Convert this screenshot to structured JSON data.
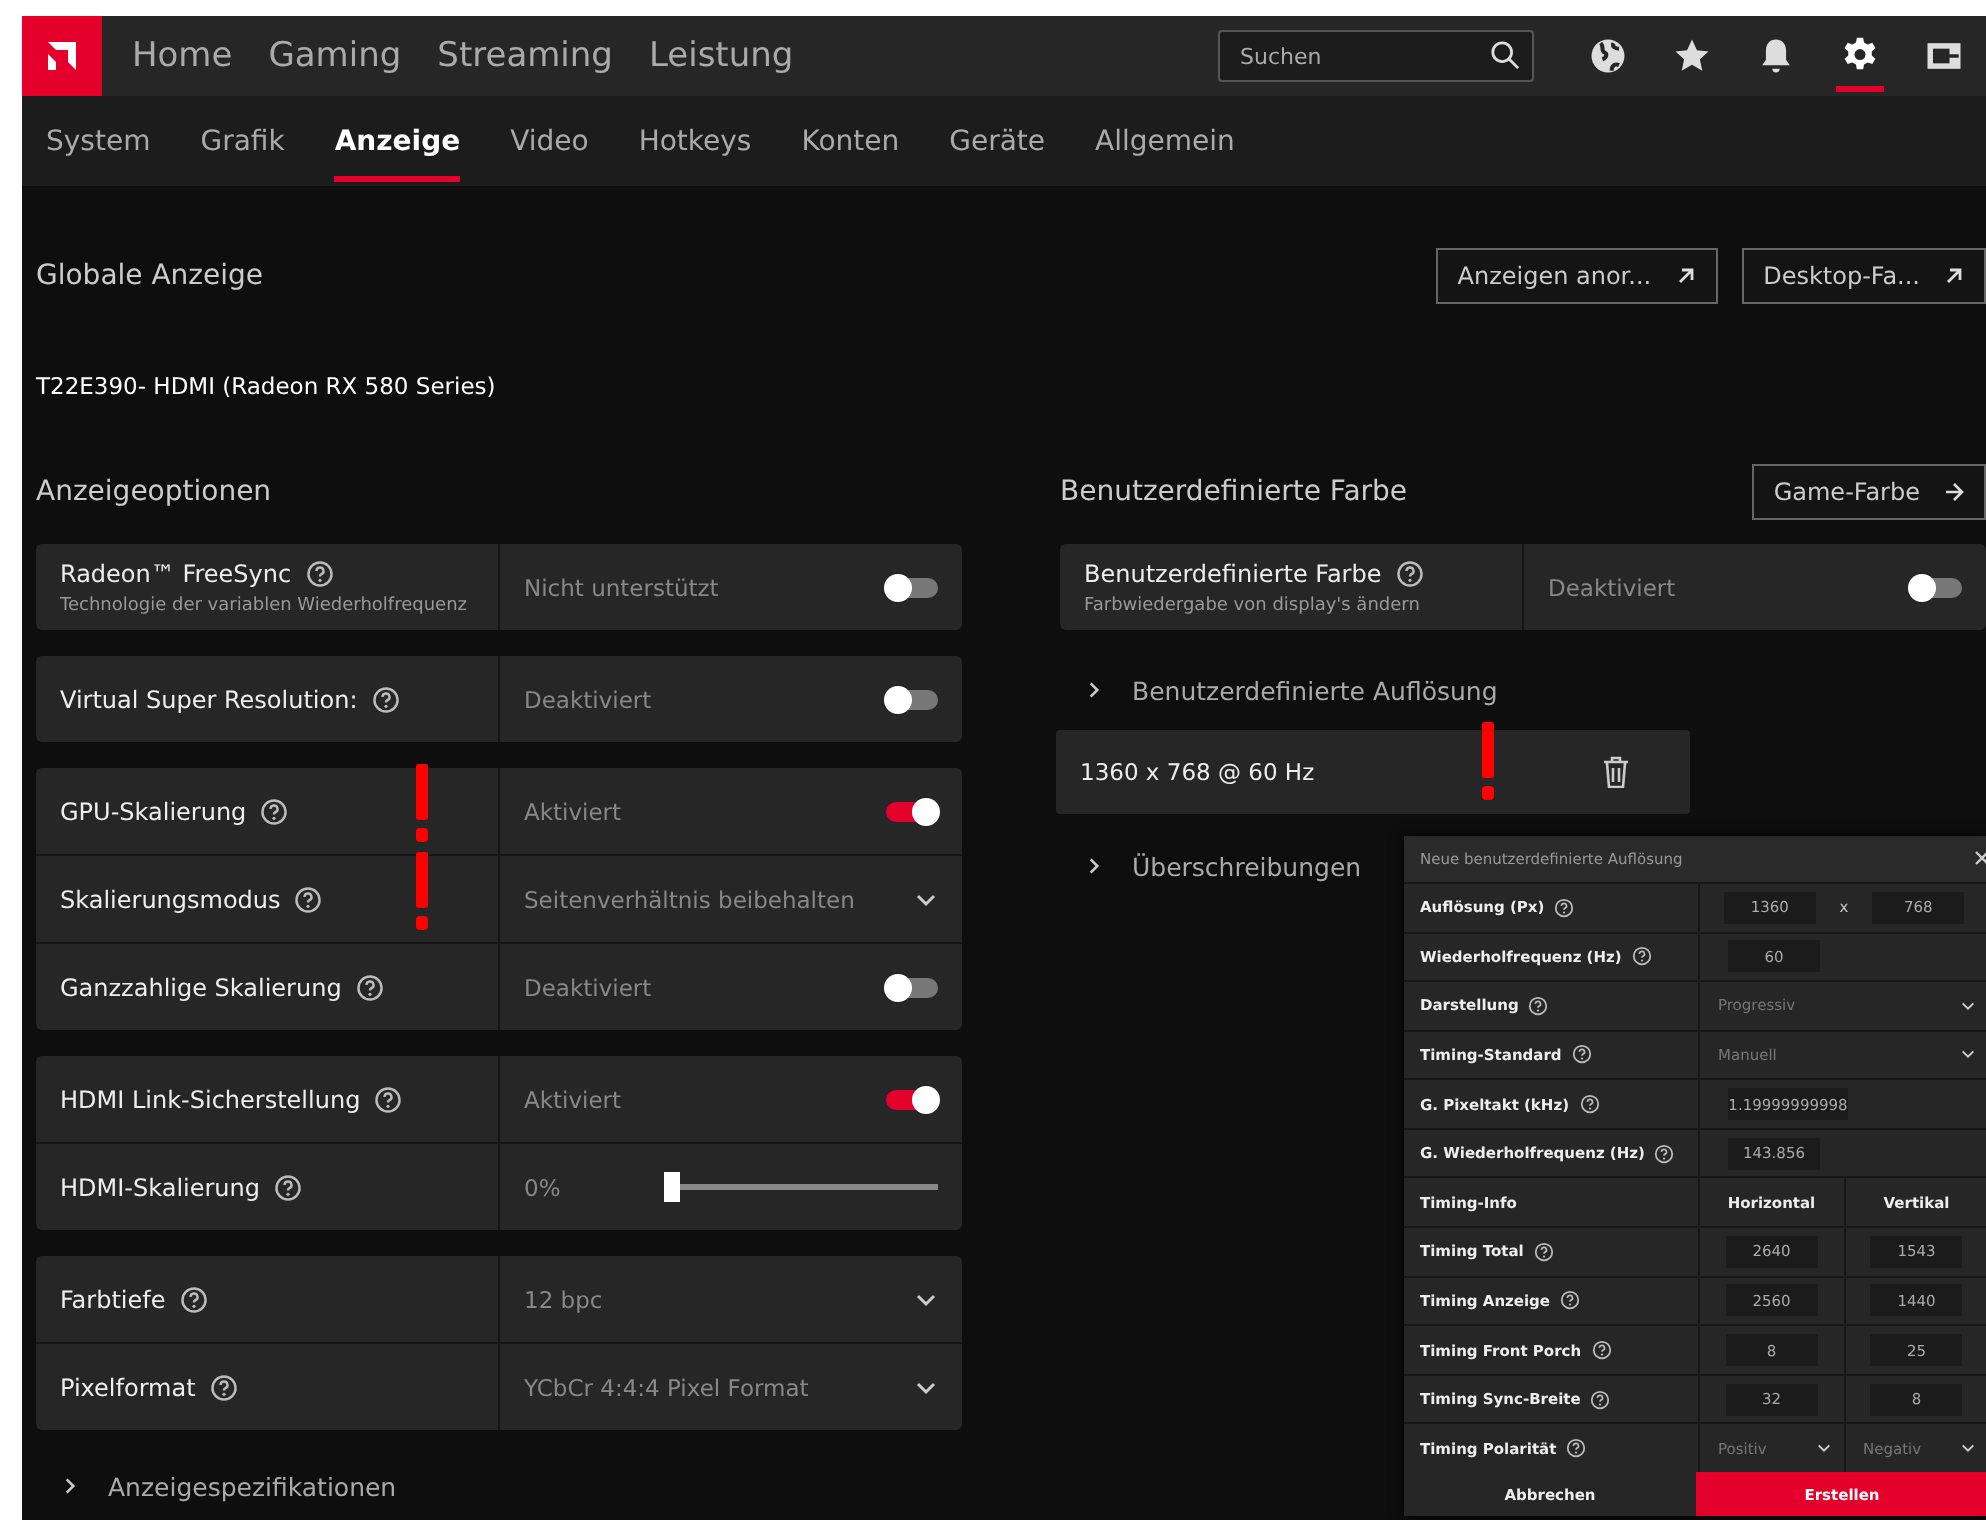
{
  "top_nav": {
    "items": [
      {
        "label": "Home",
        "selected": false
      },
      {
        "label": "Gaming",
        "selected": false
      },
      {
        "label": "Streaming",
        "selected": false
      },
      {
        "label": "Leistung",
        "selected": false
      }
    ],
    "search": {
      "placeholder": "Suchen"
    },
    "icons": [
      {
        "kind": "globe",
        "selected": false
      },
      {
        "kind": "star",
        "selected": false
      },
      {
        "kind": "bell",
        "selected": false
      },
      {
        "kind": "gear",
        "selected": true
      },
      {
        "kind": "exit",
        "selected": false
      }
    ]
  },
  "tabs": [
    {
      "label": "System",
      "selected": false
    },
    {
      "label": "Grafik",
      "selected": false
    },
    {
      "label": "Anzeige",
      "selected": true
    },
    {
      "label": "Video",
      "selected": false
    },
    {
      "label": "Hotkeys",
      "selected": false
    },
    {
      "label": "Konten",
      "selected": false
    },
    {
      "label": "Geräte",
      "selected": false
    },
    {
      "label": "Allgemein",
      "selected": false
    }
  ],
  "header": {
    "title": "Globale Anzeige",
    "buttons": [
      "Anzeigen anor...",
      "Desktop-Fa..."
    ],
    "display_name": "T22E390- HDMI (Radeon RX 580 Series)"
  },
  "display_options": {
    "title": "Anzeigeoptionen",
    "groups": [
      [
        {
          "label": "Radeon™ FreeSync",
          "subtitle": "Technologie der variablen Wiederholfrequenz",
          "kind": "toggle",
          "value": "Nicht unterstützt",
          "on": false,
          "flagged": false
        }
      ],
      [
        {
          "label": "Virtual Super Resolution:",
          "kind": "toggle",
          "value": "Deaktiviert",
          "on": false,
          "flagged": false
        }
      ],
      [
        {
          "label": "GPU-Skalierung",
          "kind": "toggle",
          "value": "Aktiviert",
          "on": true,
          "flagged": true
        },
        {
          "label": "Skalierungsmodus",
          "kind": "dropdown",
          "value": "Seitenverhältnis beibehalten",
          "flagged": true
        },
        {
          "label": "Ganzzahlige Skalierung",
          "kind": "toggle",
          "value": "Deaktiviert",
          "on": false,
          "flagged": false
        }
      ],
      [
        {
          "label": "HDMI Link-Sicherstellung",
          "kind": "toggle",
          "value": "Aktiviert",
          "on": true,
          "flagged": false
        },
        {
          "label": "HDMI-Skalierung",
          "kind": "slider",
          "value": "0%",
          "level": 0,
          "flagged": false
        }
      ],
      [
        {
          "label": "Farbtiefe",
          "kind": "dropdown",
          "value": "12 bpc",
          "flagged": false
        },
        {
          "label": "Pixelformat",
          "kind": "dropdown",
          "value": "YCbCr 4:4:4 Pixel Format",
          "flagged": false
        }
      ]
    ],
    "footer": "Anzeigespezifikationen"
  },
  "custom_color": {
    "title": "Benutzerdefinierte Farbe",
    "button": "Game-Farbe",
    "setting": {
      "label": "Benutzerdefinierte Farbe",
      "subtitle": "Farbwiedergabe von display's ändern",
      "kind": "toggle",
      "value": "Deaktiviert",
      "on": false
    },
    "custom_resolution": {
      "label": "Benutzerdefinierte Auflösung",
      "expanded": false,
      "items": [
        {
          "label": "1360 x 768 @ 60 Hz",
          "flagged": true
        }
      ]
    },
    "overrides": {
      "label": "Überschreibungen",
      "expanded": false
    }
  },
  "dialog": {
    "title": "Neue benutzerdefinierte Auflösung",
    "rows": [
      {
        "label": "Auflösung (Px)",
        "kind": "pair",
        "values": [
          "1360",
          "768"
        ],
        "separator": "x"
      },
      {
        "label": "Wiederholfrequenz (Hz)",
        "kind": "input",
        "values": [
          "60"
        ]
      },
      {
        "label": "Darstellung",
        "kind": "dropdown",
        "values": [
          "Progressiv"
        ]
      },
      {
        "label": "Timing-Standard",
        "kind": "dropdown",
        "values": [
          "Manuell"
        ]
      },
      {
        "label": "G. Pixeltakt (kHz)",
        "kind": "input",
        "values": [
          "1.19999999998"
        ]
      },
      {
        "label": "G. Wiederholfrequenz (Hz)",
        "kind": "input",
        "values": [
          "143.856"
        ]
      },
      {
        "label": "Timing-Info",
        "kind": "header",
        "values": [
          "Horizontal",
          "Vertikal"
        ]
      },
      {
        "label": "Timing Total",
        "kind": "pair",
        "values": [
          "2640",
          "1543"
        ]
      },
      {
        "label": "Timing Anzeige",
        "kind": "pair",
        "values": [
          "2560",
          "1440"
        ]
      },
      {
        "label": "Timing Front Porch",
        "kind": "pair",
        "values": [
          "8",
          "25"
        ]
      },
      {
        "label": "Timing Sync-Breite",
        "kind": "pair",
        "values": [
          "32",
          "8"
        ]
      },
      {
        "label": "Timing Polarität",
        "kind": "dropdowns",
        "values": [
          "Positiv",
          "Negativ"
        ]
      }
    ],
    "buttons": [
      "Abbrechen",
      "Erstellen"
    ]
  }
}
